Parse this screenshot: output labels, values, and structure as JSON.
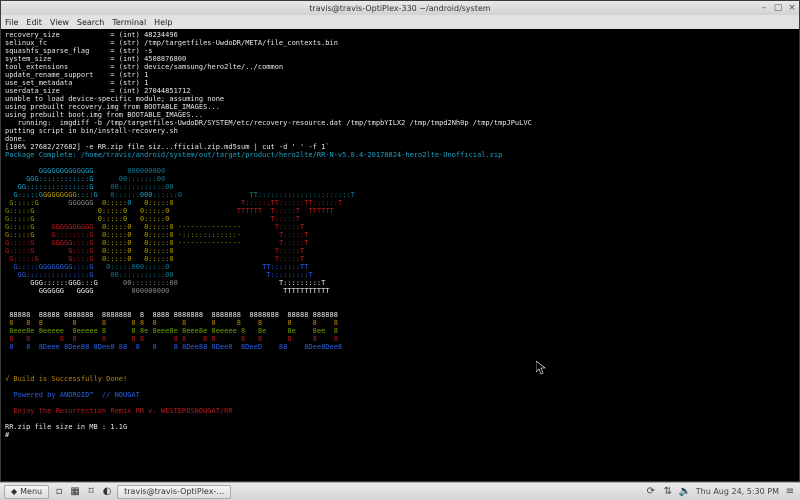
{
  "window": {
    "title": "travis@travis-OptiPlex-330 ~/android/system",
    "menu": [
      "File",
      "Edit",
      "View",
      "Search",
      "Terminal",
      "Help"
    ],
    "controls": {
      "min": "–",
      "max": "▢",
      "close": "×"
    }
  },
  "terminal": {
    "build_vars": [
      "recovery_size            = (int) 48234496",
      "selinux_fc               = (str) /tmp/targetfiles-UwdoDR/META/file_contexts.bin",
      "squashfs_sparse_flag     = (str) -s",
      "system_size              = (int) 4508876800",
      "tool_extensions          = (str) device/samsung/hero2lte/../common",
      "update_rename_support    = (str) 1",
      "use_set_metadata         = (str) 1",
      "userdata_size            = (int) 27044851712",
      "unable to load device-specific module; assuming none",
      "using prebuilt recovery.img from BOOTABLE_IMAGES...",
      "using prebuilt boot.img from BOOTABLE_IMAGES...",
      "   running:  imgdiff -b /tmp/targetfiles-UwdoDR/SYSTEM/etc/recovery-resource.dat /tmp/tmpbYILX2 /tmp/tmpd2Nh0p /tmp/tmpJPuLVC",
      "putting script in bin/install-recovery.sh",
      "done."
    ],
    "progress": "[100% 27682/27682] -e RR.zip file siz...fficial.zip.md5sum | cut -d ' ' -f 1`",
    "package_complete": "Package Complete: /home/travis/android/system/out/target/product/hero2lte/RR-N-v5.8.4-20170824-hero2lte-Unofficial.zip",
    "ascii_art": {
      "rows": [
        [
          [
            "c-grey",
            "        "
          ],
          [
            "c-cyan",
            "GGGGGGGGGGGGG        "
          ],
          [
            "c-dcyan",
            "000000000"
          ]
        ],
        [
          [
            "c-grey",
            "     "
          ],
          [
            "c-cyan",
            "GGG::::::::::::G      "
          ],
          [
            "c-dcyan",
            "00:::::::00"
          ]
        ],
        [
          [
            "c-grey",
            "   "
          ],
          [
            "c-cyan",
            "GG:::::::::::::::G    "
          ],
          [
            "c-dcyan",
            "00:::::::::::00"
          ]
        ],
        [
          [
            "c-grey",
            "  "
          ],
          [
            "c-cyan",
            "G:::::G"
          ],
          [
            "c-yellow",
            "GGGGGGGG"
          ],
          [
            "c-cyan",
            "::::G   "
          ],
          [
            "c-dcyan",
            "0::::::"
          ],
          [
            "c-cyan",
            "000"
          ],
          [
            "c-dcyan",
            "::::::0                TT::::::::::::::::::::::T"
          ]
        ],
        [
          [
            "c-grey",
            " "
          ],
          [
            "c-green",
            "G:::::G       "
          ],
          [
            "c-grey",
            "GGGGGG  "
          ],
          [
            "c-yellow",
            "0:::::"
          ],
          [
            "c-cyan",
            "0   "
          ],
          [
            "c-yellow",
            "0:::::0                "
          ],
          [
            "c-red",
            "T::::::TT::::::TT::::::T"
          ]
        ],
        [
          [
            "c-green",
            "G:::::G               "
          ],
          [
            "c-yellow",
            "0:::::0   0:::::0                "
          ],
          [
            "c-red",
            "TTTTTT  T:::::T  TTTTTT"
          ]
        ],
        [
          [
            "c-green",
            "G:::::G               "
          ],
          [
            "c-yellow",
            "0:::::0   0:::::0                        "
          ],
          [
            "c-red",
            "T:::::T"
          ]
        ],
        [
          [
            "c-green",
            "G:::::G    "
          ],
          [
            "c-red",
            "GGGGGGGGGG  "
          ],
          [
            "c-yellow",
            "0:::::0   0:::::0 "
          ],
          [
            "c-green",
            "---------------        "
          ],
          [
            "c-red",
            "T:::::T"
          ]
        ],
        [
          [
            "c-gold",
            "G:::::G    "
          ],
          [
            "c-red",
            "G::::::::G  "
          ],
          [
            "c-yellow",
            "0:::::0   0:::::0 "
          ],
          [
            "c-green",
            "-:::::::::::::-         "
          ],
          [
            "c-red",
            "T:::::T"
          ]
        ],
        [
          [
            "c-red",
            "G:::::G    GGGGG::::G  "
          ],
          [
            "c-yellow",
            "0:::::0   0:::::0 "
          ],
          [
            "c-green",
            "---------------         "
          ],
          [
            "c-red",
            "T:::::T"
          ]
        ],
        [
          [
            "c-red",
            "G:::::G        G::::G  "
          ],
          [
            "c-yellow",
            "0:::::0   0:::::0                        "
          ],
          [
            "c-red",
            "T:::::T"
          ]
        ],
        [
          [
            "c-red",
            " G:::::G       G::::G  "
          ],
          [
            "c-yellow",
            "0:::::0   0:::::0                        "
          ],
          [
            "c-red",
            "T:::::T"
          ]
        ],
        [
          [
            "c-grey",
            "  "
          ],
          [
            "c-blue",
            "G:::::GGGGGGGG::::G   "
          ],
          [
            "c-dcyan",
            "0:::::000:::::0                      "
          ],
          [
            "c-blue",
            "TT:::::::TT"
          ]
        ],
        [
          [
            "c-grey",
            "   "
          ],
          [
            "c-blue",
            "GG:::::::::::::::G    "
          ],
          [
            "c-dcyan",
            "00:::::::::::00                      "
          ],
          [
            "c-blue",
            "T:::::::::T"
          ]
        ],
        [
          [
            "c-grey",
            "      "
          ],
          [
            "c-white",
            "GGG::::::GGG:::G      "
          ],
          [
            "c-grey",
            "00:::::::::00                        "
          ],
          [
            "c-white",
            "T:::::::::T"
          ]
        ],
        [
          [
            "c-grey",
            "        "
          ],
          [
            "c-white",
            "GGGGGG   GGGG         "
          ],
          [
            "c-grey",
            "000000000                           "
          ],
          [
            "c-white",
            "TTTTTTTTTTT"
          ]
        ]
      ],
      "rr_rows": [
        [
          [
            "c-white",
            " 88888  88888 8888888  8888888  8  8888 8888888  8888888  8888888  88888 888888"
          ]
        ],
        [
          [
            "c-gold",
            " 8   8  8       8      8      8 8  8      8      8     8    8      8     8    8"
          ]
        ],
        [
          [
            "c-green",
            " 8eee8e 8eeeee  8eeeee 8      8 8e 8eee8e 8eee8e 8eeeee 8   8e     8e    8ee  8"
          ]
        ],
        [
          [
            "c-red",
            " 8   8       8  8      8      8 8       8 8    8 8      8   8      8     8    8"
          ]
        ],
        [
          [
            "c-blue",
            " 8   8  8Deee 8Dee88 8Dee8 88  8   8    8 8Dee88 8Dee8  8DeeD    88    8Dee8Dee8"
          ]
        ]
      ]
    },
    "build_done": "√ Build is Successfully Done!",
    "powered": "  Powered by ANDROID™  // NOUGAT",
    "remix_line": "  Enjoy the Resurrection Remix RR v. WESTEROSNOUGAT/RR",
    "size_line": "RR.zip file size in MB : 1.1G",
    "prompt": "#"
  },
  "taskbar": {
    "menu_label": "Menu",
    "app_button": "travis@travis-OptiPlex-…",
    "clock": "Thu Aug 24,  5:30 PM"
  }
}
